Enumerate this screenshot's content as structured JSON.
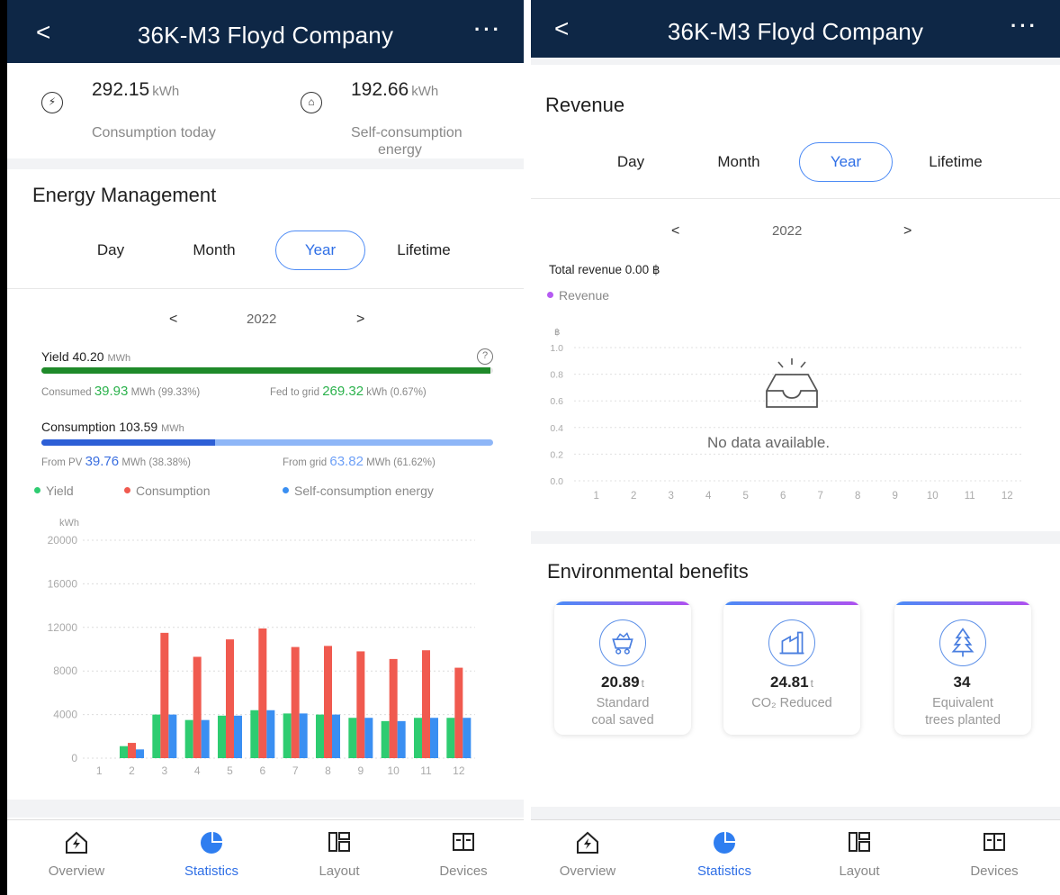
{
  "header": {
    "title": "36K-M3 Floyd Company",
    "back": "<",
    "more": "···"
  },
  "left": {
    "summary": [
      {
        "icon": "consumption-icon",
        "value": "292.15",
        "unit": "kWh",
        "label": "Consumption today"
      },
      {
        "icon": "self-consumption-icon",
        "value": "192.66",
        "unit": "kWh",
        "label_1": "Self-consumption",
        "label_2": "energy"
      }
    ],
    "section_title": "Energy Management",
    "tabs": [
      "Day",
      "Month",
      "Year",
      "Lifetime"
    ],
    "active_tab": "Year",
    "year": "2022",
    "yield": {
      "label": "Yield",
      "value": "40.20",
      "unit": "MWh",
      "consumed_fraction": 0.9933
    },
    "yield_sub": {
      "consumed_label": "Consumed",
      "consumed_value": "39.93",
      "consumed_unit": "MWh (99.33%)",
      "fed_label": "Fed to grid",
      "fed_value": "269.32",
      "fed_unit": "kWh (0.67%)"
    },
    "consumption": {
      "label": "Consumption",
      "value": "103.59",
      "unit": "MWh",
      "pv_fraction": 0.3838
    },
    "consumption_sub": {
      "pv_label": "From PV",
      "pv_value": "39.76",
      "pv_unit": "MWh (38.38%)",
      "grid_label": "From grid",
      "grid_value": "63.82",
      "grid_unit": "MWh (61.62%)"
    },
    "legend": [
      "Yield",
      "Consumption",
      "Self-consumption energy"
    ]
  },
  "right": {
    "section_title": "Revenue",
    "tabs": [
      "Day",
      "Month",
      "Year",
      "Lifetime"
    ],
    "active_tab": "Year",
    "year": "2022",
    "total_revenue": "Total revenue 0.00 ฿",
    "legend": "Revenue",
    "no_data": "No data available.",
    "env_title": "Environmental benefits",
    "env_cards": [
      {
        "icon": "coal-cart-icon",
        "value": "20.89",
        "unit": "t",
        "label_1": "Standard",
        "label_2": "coal saved"
      },
      {
        "icon": "factory-icon",
        "value": "24.81",
        "unit": "t",
        "label_1": "CO₂ Reduced",
        "label_2": ""
      },
      {
        "icon": "tree-icon",
        "value": "34",
        "unit": "",
        "label_1": "Equivalent",
        "label_2": "trees planted"
      }
    ]
  },
  "nav": [
    "Overview",
    "Statistics",
    "Layout",
    "Devices"
  ],
  "nav_active": "Statistics",
  "colors": {
    "header": "#0e2746",
    "yield": "#2ecc71",
    "consumption": "#f05a4f",
    "self": "#3a8ff2",
    "revenue": "#b55bf2",
    "accent": "#2f6fe6"
  },
  "chart_data": [
    {
      "type": "bar",
      "title": "",
      "xlabel": "",
      "ylabel": "kWh",
      "categories": [
        "1",
        "2",
        "3",
        "4",
        "5",
        "6",
        "7",
        "8",
        "9",
        "10",
        "11",
        "12"
      ],
      "ylim": [
        0,
        20000
      ],
      "yticks": [
        0,
        4000,
        8000,
        12000,
        16000,
        20000
      ],
      "series": [
        {
          "name": "Yield",
          "color": "#2ecc71",
          "values": [
            0,
            1100,
            4000,
            3500,
            3900,
            4400,
            4100,
            4000,
            3700,
            3400,
            3700,
            3700
          ]
        },
        {
          "name": "Consumption",
          "color": "#f05a4f",
          "values": [
            0,
            1400,
            11500,
            9300,
            10900,
            11900,
            10200,
            10300,
            9800,
            9100,
            9900,
            8300
          ]
        },
        {
          "name": "Self-consumption energy",
          "color": "#3a8ff2",
          "values": [
            0,
            800,
            4000,
            3500,
            3900,
            4400,
            4100,
            4000,
            3700,
            3400,
            3700,
            3700
          ]
        }
      ],
      "grid": true,
      "legend_position": "top"
    },
    {
      "type": "bar",
      "title": "",
      "ylabel": "฿",
      "categories": [
        "1",
        "2",
        "3",
        "4",
        "5",
        "6",
        "7",
        "8",
        "9",
        "10",
        "11",
        "12"
      ],
      "ylim": [
        0,
        1.0
      ],
      "yticks": [
        "0.0",
        "0.2",
        "0.4",
        "0.6",
        "0.8",
        "1.0"
      ],
      "series": [
        {
          "name": "Revenue",
          "color": "#b55bf2",
          "values": []
        }
      ],
      "grid": true
    }
  ]
}
